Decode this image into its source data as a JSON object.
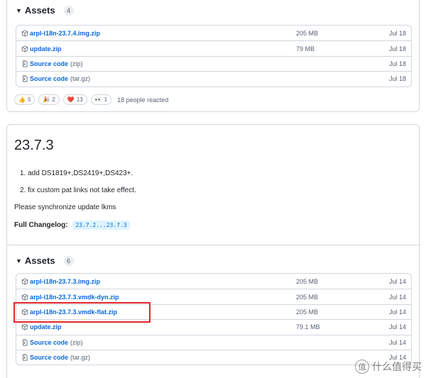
{
  "top_release": {
    "assets_label": "Assets",
    "assets_count": "4",
    "assets": [
      {
        "name": "arpl-i18n-23.7.4.img.zip",
        "ext": "",
        "size": "205 MB",
        "date": "Jul 18",
        "icon": "package-icon"
      },
      {
        "name": "update.zip",
        "ext": "",
        "size": "79 MB",
        "date": "Jul 18",
        "icon": "package-icon"
      },
      {
        "name": "Source code",
        "ext": "(zip)",
        "size": "",
        "date": "Jul 18",
        "icon": "file-zip-icon"
      },
      {
        "name": "Source code",
        "ext": "(tar.gz)",
        "size": "",
        "date": "Jul 18",
        "icon": "file-zip-icon"
      }
    ],
    "reactions": [
      {
        "emoji": "👍",
        "count": "5"
      },
      {
        "emoji": "🎉",
        "count": "2"
      },
      {
        "emoji": "❤️",
        "count": "13"
      },
      {
        "emoji": "👀",
        "count": "1"
      }
    ],
    "reacted_text": "18 people reacted"
  },
  "release": {
    "title": "23.7.3",
    "notes": [
      "1. add DS1819+,DS2419+,DS423+.",
      "2. fix custom pat links not take effect."
    ],
    "sync_text": "Please synchronize update lkms",
    "changelog_label": "Full Changelog",
    "changelog_colon": ":",
    "changelog_range": "23.7.2...23.7.3",
    "assets_label": "Assets",
    "assets_count": "6",
    "assets": [
      {
        "name": "arpl-i18n-23.7.3.img.zip",
        "ext": "",
        "size": "205 MB",
        "date": "Jul 14",
        "icon": "package-icon"
      },
      {
        "name": "arpl-i18n-23.7.3.vmdk-dyn.zip",
        "ext": "",
        "size": "205 MB",
        "date": "Jul 14",
        "icon": "package-icon"
      },
      {
        "name": "arpl-i18n-23.7.3.vmdk-flat.zip",
        "ext": "",
        "size": "205 MB",
        "date": "Jul 14",
        "icon": "package-icon"
      },
      {
        "name": "update.zip",
        "ext": "",
        "size": "79.1 MB",
        "date": "Jul 14",
        "icon": "package-icon"
      },
      {
        "name": "Source code",
        "ext": "(zip)",
        "size": "",
        "date": "Jul 14",
        "icon": "file-zip-icon"
      },
      {
        "name": "Source code",
        "ext": "(tar.gz)",
        "size": "",
        "date": "Jul 14",
        "icon": "file-zip-icon"
      }
    ]
  },
  "watermark": {
    "logo_char": "值",
    "text": "什么值得买"
  },
  "colors": {
    "link": "#0969da",
    "border": "#d0d7de",
    "highlight": "#e3262b"
  }
}
